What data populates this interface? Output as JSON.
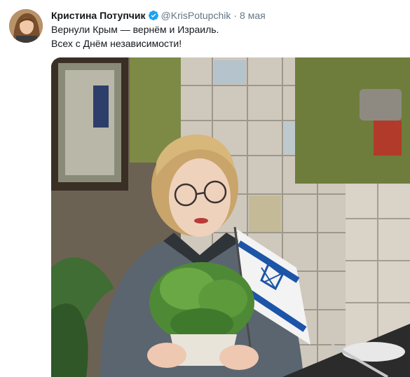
{
  "author": {
    "name": "Кристина Потупчик",
    "handle": "@KrisPotupchik",
    "verified": true
  },
  "tweet": {
    "date": "8 мая",
    "line1": "Вернули Крым — вернём и Израиль.",
    "line2": "Всех с Днём независимости!"
  },
  "media": {
    "icon": "photo"
  },
  "colors": {
    "name": "#14171a",
    "meta": "#657786",
    "verified": "#1da1f2"
  }
}
